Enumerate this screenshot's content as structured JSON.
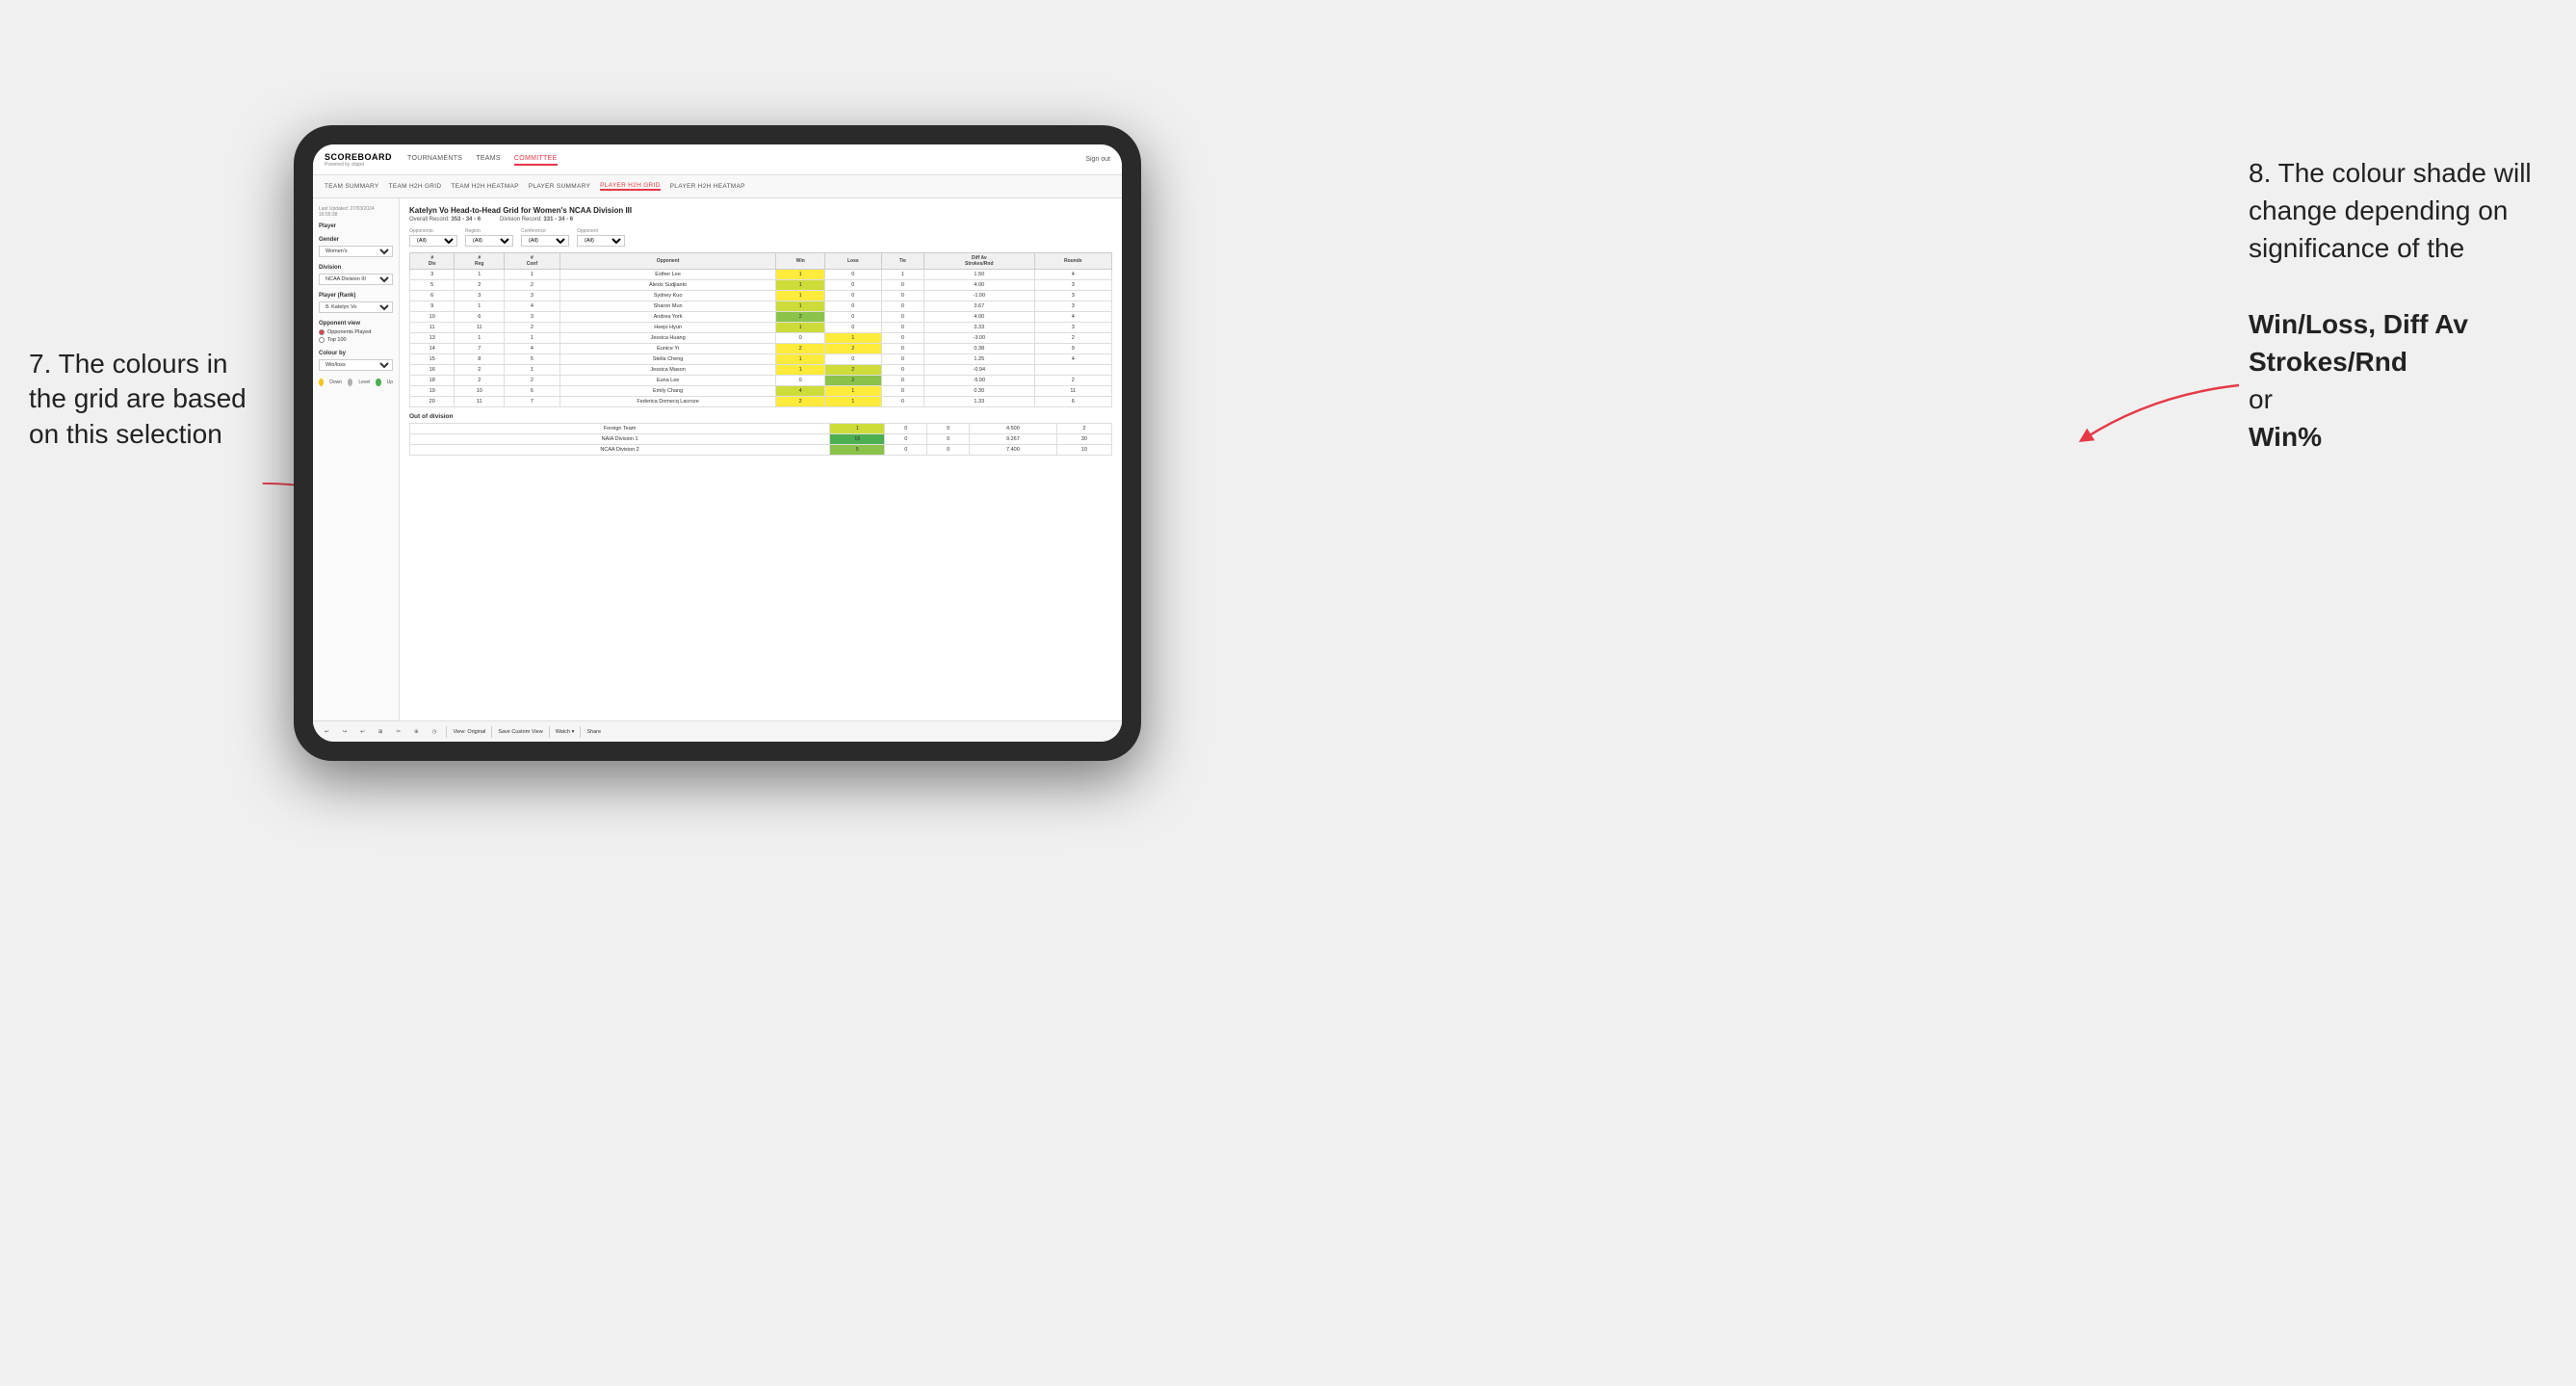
{
  "annotations": {
    "left_title": "7. The colours in the grid are based on this selection",
    "right_title": "8. The colour shade will change depending on significance of the",
    "right_bold1": "Win/Loss,",
    "right_bold2": "Diff Av Strokes/Rnd",
    "right_bold3": "or",
    "right_bold4": "Win%"
  },
  "nav": {
    "logo": "SCOREBOARD",
    "logo_sub": "Powered by clippd",
    "items": [
      "TOURNAMENTS",
      "TEAMS",
      "COMMITTEE"
    ],
    "active_item": "COMMITTEE",
    "right_items": [
      "Sign out"
    ]
  },
  "sub_nav": {
    "items": [
      "TEAM SUMMARY",
      "TEAM H2H GRID",
      "TEAM H2H HEATMAP",
      "PLAYER SUMMARY",
      "PLAYER H2H GRID",
      "PLAYER H2H HEATMAP"
    ],
    "active_item": "PLAYER H2H GRID"
  },
  "sidebar": {
    "timestamp": "Last Updated: 27/03/2024 16:55:38",
    "player_label": "Player",
    "gender_label": "Gender",
    "gender_value": "Women's",
    "division_label": "Division",
    "division_value": "NCAA Division III",
    "player_rank_label": "Player (Rank)",
    "player_rank_value": "8. Katelyn Vo",
    "opponent_view_label": "Opponent view",
    "opponent_view_options": [
      "Opponents Played",
      "Top 100"
    ],
    "opponent_view_selected": "Opponents Played",
    "colour_by_label": "Colour by",
    "colour_by_value": "Win/loss",
    "legend": {
      "down_label": "Down",
      "level_label": "Level",
      "up_label": "Up",
      "down_color": "#f5c518",
      "level_color": "#b0b0b0",
      "up_color": "#4caf50"
    }
  },
  "grid": {
    "title": "Katelyn Vo Head-to-Head Grid for Women's NCAA Division III",
    "overall_record_label": "Overall Record:",
    "overall_record_value": "353 - 34 - 6",
    "division_record_label": "Division Record:",
    "division_record_value": "331 - 34 - 6",
    "filters": {
      "opponents_label": "Opponents:",
      "opponents_value": "(All)",
      "region_label": "Region",
      "conference_label": "Conference",
      "opponent_label": "Opponent",
      "region_value": "(All)",
      "conference_value": "(All)",
      "opponent_value": "(All)"
    },
    "columns": [
      "#\nDiv",
      "#\nReg",
      "#\nConf",
      "Opponent",
      "Win",
      "Loss",
      "Tie",
      "Diff Av\nStrokes/Rnd",
      "Rounds"
    ],
    "rows": [
      {
        "div": "3",
        "reg": "1",
        "conf": "1",
        "opponent": "Esther Lee",
        "win": "1",
        "loss": "0",
        "tie": "1",
        "diff": "1.50",
        "rounds": "4",
        "win_class": "cell-yellow",
        "loss_class": "",
        "tie_class": ""
      },
      {
        "div": "5",
        "reg": "2",
        "conf": "2",
        "opponent": "Alexis Sudjianto",
        "win": "1",
        "loss": "0",
        "tie": "0",
        "diff": "4.00",
        "rounds": "3",
        "win_class": "cell-green-light",
        "loss_class": "",
        "tie_class": ""
      },
      {
        "div": "6",
        "reg": "3",
        "conf": "3",
        "opponent": "Sydney Kuo",
        "win": "1",
        "loss": "0",
        "tie": "0",
        "diff": "-1.00",
        "rounds": "3",
        "win_class": "cell-yellow",
        "loss_class": "",
        "tie_class": ""
      },
      {
        "div": "9",
        "reg": "1",
        "conf": "4",
        "opponent": "Sharon Mun",
        "win": "1",
        "loss": "0",
        "tie": "0",
        "diff": "3.67",
        "rounds": "3",
        "win_class": "cell-green-light",
        "loss_class": "",
        "tie_class": ""
      },
      {
        "div": "10",
        "reg": "6",
        "conf": "3",
        "opponent": "Andrea York",
        "win": "2",
        "loss": "0",
        "tie": "0",
        "diff": "4.00",
        "rounds": "4",
        "win_class": "cell-green-mid",
        "loss_class": "",
        "tie_class": ""
      },
      {
        "div": "11",
        "reg": "11",
        "conf": "2",
        "opponent": "Heejo Hyun",
        "win": "1",
        "loss": "0",
        "tie": "0",
        "diff": "3.33",
        "rounds": "3",
        "win_class": "cell-green-light",
        "loss_class": "",
        "tie_class": ""
      },
      {
        "div": "13",
        "reg": "1",
        "conf": "1",
        "opponent": "Jessica Huang",
        "win": "0",
        "loss": "1",
        "tie": "0",
        "diff": "-3.00",
        "rounds": "2",
        "win_class": "",
        "loss_class": "cell-yellow",
        "tie_class": ""
      },
      {
        "div": "14",
        "reg": "7",
        "conf": "4",
        "opponent": "Eunice Yi",
        "win": "2",
        "loss": "2",
        "tie": "0",
        "diff": "0.38",
        "rounds": "9",
        "win_class": "cell-yellow",
        "loss_class": "cell-yellow",
        "tie_class": ""
      },
      {
        "div": "15",
        "reg": "8",
        "conf": "5",
        "opponent": "Stella Cheng",
        "win": "1",
        "loss": "0",
        "tie": "0",
        "diff": "1.25",
        "rounds": "4",
        "win_class": "cell-yellow",
        "loss_class": "",
        "tie_class": ""
      },
      {
        "div": "16",
        "reg": "2",
        "conf": "1",
        "opponent": "Jessica Mason",
        "win": "1",
        "loss": "2",
        "tie": "0",
        "diff": "-0.94",
        "rounds": "",
        "win_class": "cell-yellow",
        "loss_class": "cell-green-light",
        "tie_class": ""
      },
      {
        "div": "18",
        "reg": "2",
        "conf": "2",
        "opponent": "Euna Lee",
        "win": "0",
        "loss": "2",
        "tie": "0",
        "diff": "-5.00",
        "rounds": "2",
        "win_class": "",
        "loss_class": "cell-green-mid",
        "tie_class": ""
      },
      {
        "div": "19",
        "reg": "10",
        "conf": "6",
        "opponent": "Emily Chang",
        "win": "4",
        "loss": "1",
        "tie": "0",
        "diff": "0.30",
        "rounds": "11",
        "win_class": "cell-green-light",
        "loss_class": "cell-yellow",
        "tie_class": ""
      },
      {
        "div": "20",
        "reg": "11",
        "conf": "7",
        "opponent": "Federica Domecq Lacroze",
        "win": "2",
        "loss": "1",
        "tie": "0",
        "diff": "1.33",
        "rounds": "6",
        "win_class": "cell-yellow",
        "loss_class": "cell-yellow",
        "tie_class": ""
      }
    ],
    "out_of_division_label": "Out of division",
    "out_of_division_rows": [
      {
        "name": "Foreign Team",
        "win": "1",
        "loss": "0",
        "tie": "0",
        "diff": "4.500",
        "rounds": "2",
        "win_class": "cell-green-light",
        "loss_class": "",
        "tie_class": ""
      },
      {
        "name": "NAIA Division 1",
        "win": "15",
        "loss": "0",
        "tie": "0",
        "diff": "9.267",
        "rounds": "30",
        "win_class": "cell-green-dark",
        "loss_class": "",
        "tie_class": ""
      },
      {
        "name": "NCAA Division 2",
        "win": "5",
        "loss": "0",
        "tie": "0",
        "diff": "7.400",
        "rounds": "10",
        "win_class": "cell-green-mid",
        "loss_class": "",
        "tie_class": ""
      }
    ]
  },
  "toolbar": {
    "buttons": [
      "↩",
      "↪",
      "↩",
      "⊞",
      "✂",
      "⊕",
      "◷"
    ],
    "view_original": "View: Original",
    "save_custom": "Save Custom View",
    "watch": "Watch ▾",
    "share": "Share"
  }
}
